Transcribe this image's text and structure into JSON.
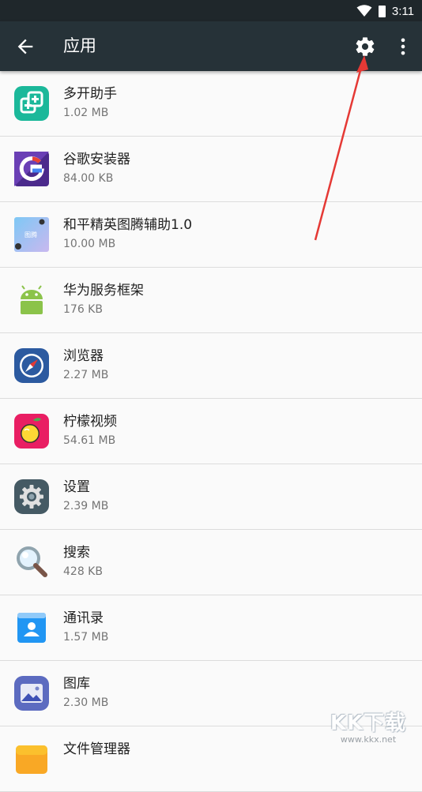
{
  "status_bar": {
    "time": "3:11"
  },
  "app_bar": {
    "title": "应用"
  },
  "apps": [
    {
      "name": "多开助手",
      "size": "1.02 MB",
      "icon": "multi-open-icon"
    },
    {
      "name": "谷歌安装器",
      "size": "84.00 KB",
      "icon": "google-installer-icon"
    },
    {
      "name": "和平精英图腾辅助1.0",
      "size": "10.00 MB",
      "icon": "pubg-assist-icon"
    },
    {
      "name": "华为服务框架",
      "size": "176 KB",
      "icon": "android-icon"
    },
    {
      "name": "浏览器",
      "size": "2.27 MB",
      "icon": "browser-compass-icon"
    },
    {
      "name": "柠檬视频",
      "size": "54.61 MB",
      "icon": "lemon-video-icon"
    },
    {
      "name": "设置",
      "size": "2.39 MB",
      "icon": "settings-gear-icon"
    },
    {
      "name": "搜索",
      "size": "428 KB",
      "icon": "search-icon"
    },
    {
      "name": "通讯录",
      "size": "1.57 MB",
      "icon": "contacts-icon"
    },
    {
      "name": "图库",
      "size": "2.30 MB",
      "icon": "gallery-icon"
    },
    {
      "name": "文件管理器",
      "size": "",
      "icon": "file-manager-icon"
    }
  ],
  "icons": {
    "multi_open_color": "#1bb89a",
    "google_installer_color": "#4b2a8c",
    "android_color": "#8bc34a",
    "browser_color": "#2c5aa0",
    "lemon_video_color": "#e91e63",
    "settings_color": "#455a64",
    "contacts_color": "#2196f3",
    "gallery_color": "#5c6bc0",
    "annotation_arrow_color": "#e53935"
  },
  "watermark": {
    "logo": "KK下载",
    "url": "www.kkx.net"
  }
}
